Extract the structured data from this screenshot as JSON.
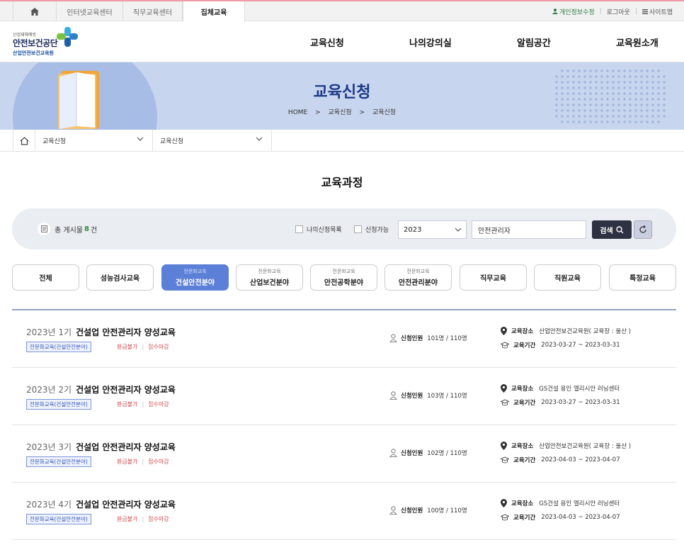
{
  "topbar": {
    "tabs": [
      "인터넷교육센터",
      "직무교육센터",
      "집체교육"
    ],
    "util": [
      "개인정보수정",
      "로그아웃",
      "사이트맵"
    ]
  },
  "logo": {
    "small": "산업재해예방",
    "main": "안전보건공단",
    "sub": "산업안전보건교육원"
  },
  "gnb": [
    "교육신청",
    "나의강의실",
    "알림공간",
    "교육원소개"
  ],
  "banner": {
    "title": "교육신청",
    "crumbs": [
      "HOME",
      "교육신청",
      "교육신청"
    ]
  },
  "location": {
    "sel1": "교육신청",
    "sel2": "교육신청"
  },
  "page_title": "교육과정",
  "search": {
    "total_prefix": "총 게시물",
    "total_count": "8",
    "total_suffix": "건",
    "chk1": "나의신청목록",
    "chk2": "신청가능",
    "year": "2023",
    "keyword": "안전관리자",
    "search_label": "검색"
  },
  "categories": [
    {
      "sub": "",
      "main": "전체"
    },
    {
      "sub": "",
      "main": "성능검사교육"
    },
    {
      "sub": "전문화교육",
      "main": "건설안전분야"
    },
    {
      "sub": "전문화교육",
      "main": "산업보건분야"
    },
    {
      "sub": "전문화교육",
      "main": "안전공학분야"
    },
    {
      "sub": "전문화교육",
      "main": "안전관리분야"
    },
    {
      "sub": "",
      "main": "직무교육"
    },
    {
      "sub": "",
      "main": "직원교육"
    },
    {
      "sub": "",
      "main": "특정교육"
    }
  ],
  "labels": {
    "applicants": "신청인원",
    "place": "교육장소",
    "period": "교육기간"
  },
  "courses": [
    {
      "term": "2023년 1기",
      "name": "건설업 안전관리자 양성교육",
      "badge": "전문화교육(건설안전분야)",
      "refund": "환급불가",
      "status": "접수마감",
      "count": "101명 / 110명",
      "place": "산업안전보건교육원( 교육장 : 울산 )",
      "period": "2023-03-27 ~ 2023-03-31"
    },
    {
      "term": "2023년 2기",
      "name": "건설업 안전관리자 양성교육",
      "badge": "전문화교육(건설안전분야)",
      "refund": "환급불가",
      "status": "접수마감",
      "count": "103명 / 110명",
      "place": "GS건설 용인 엘리시안 러닝센터",
      "period": "2023-03-27 ~ 2023-03-31"
    },
    {
      "term": "2023년 3기",
      "name": "건설업 안전관리자 양성교육",
      "badge": "전문화교육(건설안전분야)",
      "refund": "환급불가",
      "status": "접수마감",
      "count": "102명 / 110명",
      "place": "산업안전보건교육원( 교육장 : 울산 )",
      "period": "2023-04-03 ~ 2023-04-07"
    },
    {
      "term": "2023년 4기",
      "name": "건설업 안전관리자 양성교육",
      "badge": "전문화교육(건설안전분야)",
      "refund": "환급불가",
      "status": "접수마감",
      "count": "100명 / 110명",
      "place": "GS건설 용인 엘리시안 러닝센터",
      "period": "2023-04-03 ~ 2023-04-07"
    }
  ],
  "colors": {
    "active_tab": "#5c7fd8",
    "banner_bg": "#c8d5ee",
    "banner_title": "#1c3a86",
    "status_red": "#d24a4a",
    "count_green": "#2a8a3a"
  }
}
